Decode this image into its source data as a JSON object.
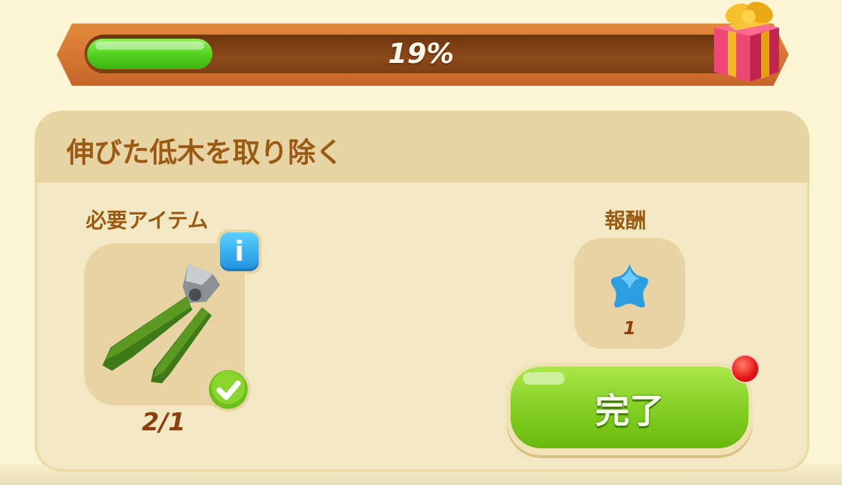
{
  "progress": {
    "percent_value": 19,
    "label": "19%"
  },
  "quest": {
    "title": "伸びた低木を取り除く",
    "required_items_label": "必要アイテム",
    "item": {
      "icon": "pruning-shears-icon",
      "count_text": "2/1",
      "status_icon": "check-icon"
    },
    "rewards_label": "報酬",
    "reward": {
      "icon": "blue-star-icon",
      "count": "1"
    },
    "complete_button_label": "完了"
  },
  "colors": {
    "accent_brown": "#9b5a14",
    "progress_green": "#4fcf1e",
    "button_green": "#7fcc1f",
    "info_blue": "#1e90df",
    "alert_red": "#e21414"
  }
}
